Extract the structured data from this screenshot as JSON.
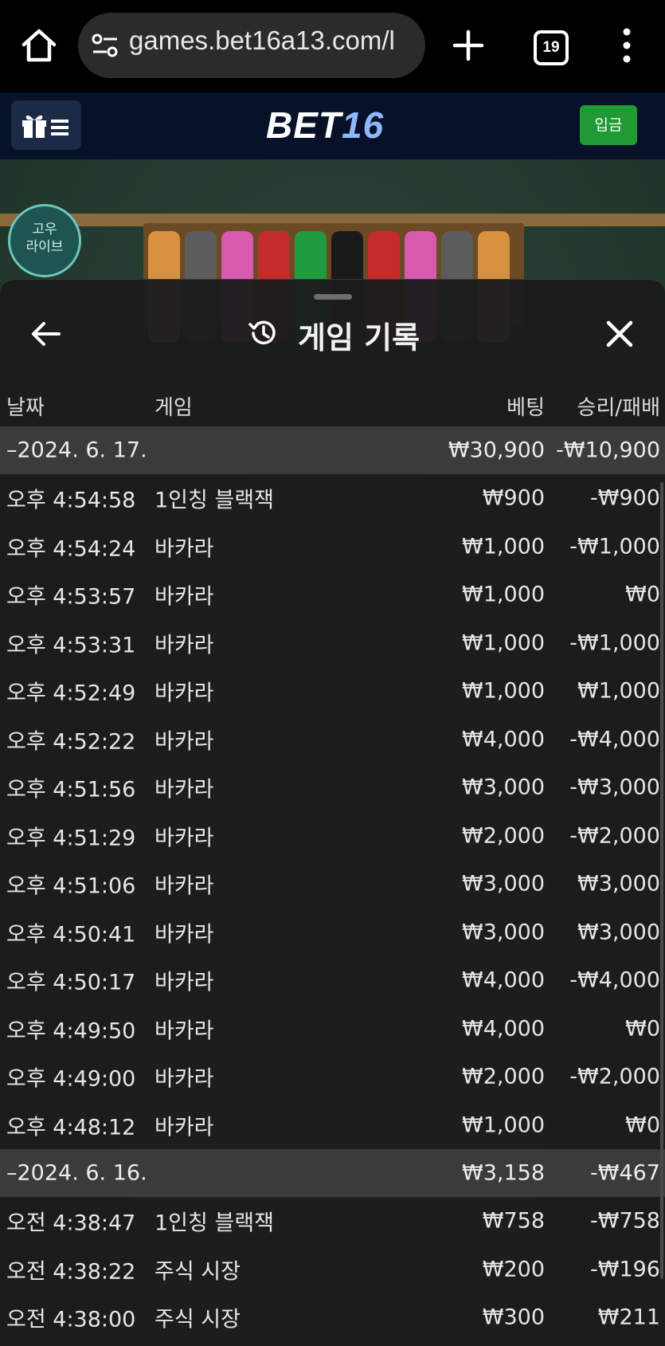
{
  "browser": {
    "url": "games.bet16a13.com/l",
    "tab_count": "19"
  },
  "site": {
    "logo_part1": "BET",
    "logo_part2": "16",
    "deposit_label": "입금"
  },
  "game": {
    "badge_line1": "고우",
    "badge_line2": "라이브"
  },
  "panel": {
    "title": "게임 기록",
    "columns": {
      "date": "날짜",
      "game": "게임",
      "bet": "베팅",
      "result": "승리/패배"
    }
  },
  "groups": [
    {
      "date": "–2024. 6. 17.",
      "bet_total": "₩30,900",
      "result_total": "-₩10,900",
      "rows": [
        {
          "time": "오후 4:54:58",
          "game": "1인칭 블랙잭",
          "bet": "₩900",
          "result": "-₩900"
        },
        {
          "time": "오후 4:54:24",
          "game": "바카라",
          "bet": "₩1,000",
          "result": "-₩1,000"
        },
        {
          "time": "오후 4:53:57",
          "game": "바카라",
          "bet": "₩1,000",
          "result": "₩0"
        },
        {
          "time": "오후 4:53:31",
          "game": "바카라",
          "bet": "₩1,000",
          "result": "-₩1,000"
        },
        {
          "time": "오후 4:52:49",
          "game": "바카라",
          "bet": "₩1,000",
          "result": "₩1,000"
        },
        {
          "time": "오후 4:52:22",
          "game": "바카라",
          "bet": "₩4,000",
          "result": "-₩4,000"
        },
        {
          "time": "오후 4:51:56",
          "game": "바카라",
          "bet": "₩3,000",
          "result": "-₩3,000"
        },
        {
          "time": "오후 4:51:29",
          "game": "바카라",
          "bet": "₩2,000",
          "result": "-₩2,000"
        },
        {
          "time": "오후 4:51:06",
          "game": "바카라",
          "bet": "₩3,000",
          "result": "₩3,000"
        },
        {
          "time": "오후 4:50:41",
          "game": "바카라",
          "bet": "₩3,000",
          "result": "₩3,000"
        },
        {
          "time": "오후 4:50:17",
          "game": "바카라",
          "bet": "₩4,000",
          "result": "-₩4,000"
        },
        {
          "time": "오후 4:49:50",
          "game": "바카라",
          "bet": "₩4,000",
          "result": "₩0"
        },
        {
          "time": "오후 4:49:00",
          "game": "바카라",
          "bet": "₩2,000",
          "result": "-₩2,000"
        },
        {
          "time": "오후 4:48:12",
          "game": "바카라",
          "bet": "₩1,000",
          "result": "₩0"
        }
      ]
    },
    {
      "date": "–2024. 6. 16.",
      "bet_total": "₩3,158",
      "result_total": "-₩467",
      "rows": [
        {
          "time": "오전 4:38:47",
          "game": "1인칭 블랙잭",
          "bet": "₩758",
          "result": "-₩758"
        },
        {
          "time": "오전 4:38:22",
          "game": "주식 시장",
          "bet": "₩200",
          "result": "-₩196"
        },
        {
          "time": "오전 4:38:00",
          "game": "주식 시장",
          "bet": "₩300",
          "result": "₩211"
        }
      ]
    }
  ]
}
